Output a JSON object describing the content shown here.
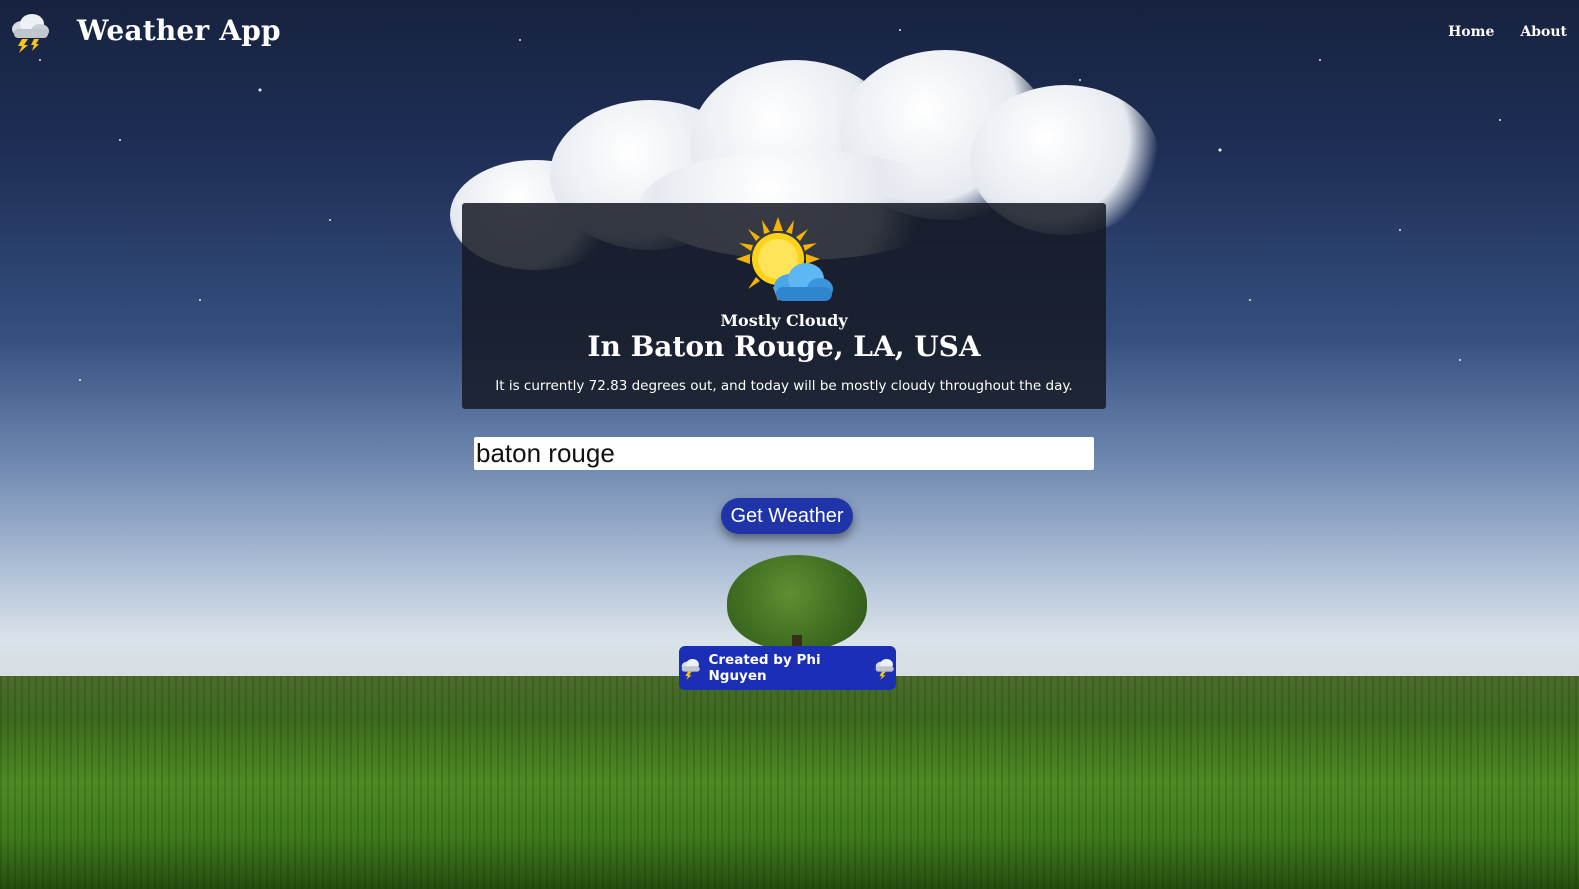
{
  "header": {
    "title": "Weather App",
    "logo_icon": "thunderstorm-cloud-icon",
    "nav": [
      {
        "label": "Home"
      },
      {
        "label": "About"
      }
    ]
  },
  "weather": {
    "icon": "partly-cloudy-sun-icon",
    "condition": "Mostly Cloudy",
    "location": "In Baton Rouge, LA, USA",
    "summary": "It is currently 72.83 degrees out, and today will be mostly cloudy throughout the day."
  },
  "search": {
    "value": "baton rouge",
    "button_label": "Get Weather"
  },
  "footer": {
    "credit": "Created by Phi Nguyen",
    "icon": "thunderstorm-cloud-icon"
  },
  "colors": {
    "button": "#1e34a8",
    "card_bg": "#161a24",
    "credit_bg": "#1a2fb5"
  }
}
